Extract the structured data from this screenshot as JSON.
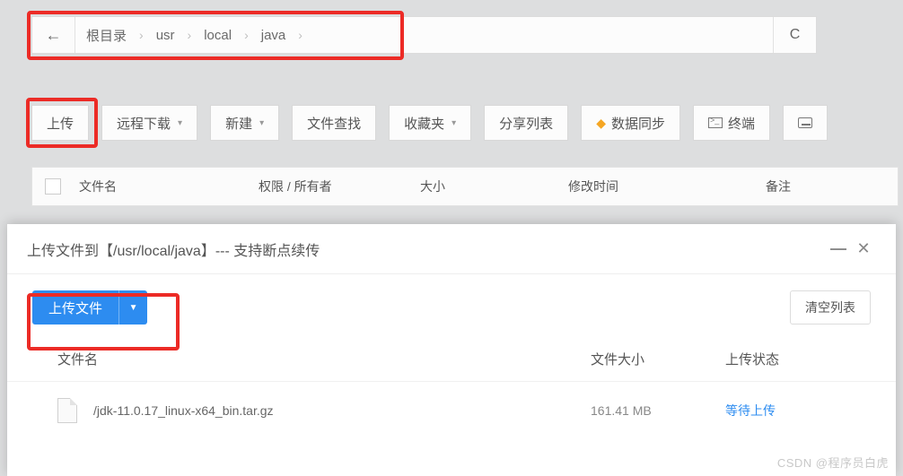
{
  "breadcrumb": {
    "root": "根目录",
    "items": [
      "usr",
      "local",
      "java"
    ]
  },
  "toolbar": {
    "upload": "上传",
    "remote_dl": "远程下载",
    "new": "新建",
    "file_find": "文件查找",
    "favorites": "收藏夹",
    "share_list": "分享列表",
    "data_sync": "数据同步",
    "terminal": "终端"
  },
  "table_headers": {
    "filename": "文件名",
    "perm_owner": "权限 / 所有者",
    "size": "大小",
    "mtime": "修改时间",
    "note": "备注"
  },
  "modal": {
    "title": "上传文件到【/usr/local/java】--- 支持断点续传",
    "upload_file": "上传文件",
    "clear_list": "清空列表",
    "col_name": "文件名",
    "col_size": "文件大小",
    "col_status": "上传状态",
    "rows": [
      {
        "name": "/jdk-11.0.17_linux-x64_bin.tar.gz",
        "size": "161.41 MB",
        "status": "等待上传"
      }
    ]
  },
  "watermark": "CSDN @程序员白虎"
}
